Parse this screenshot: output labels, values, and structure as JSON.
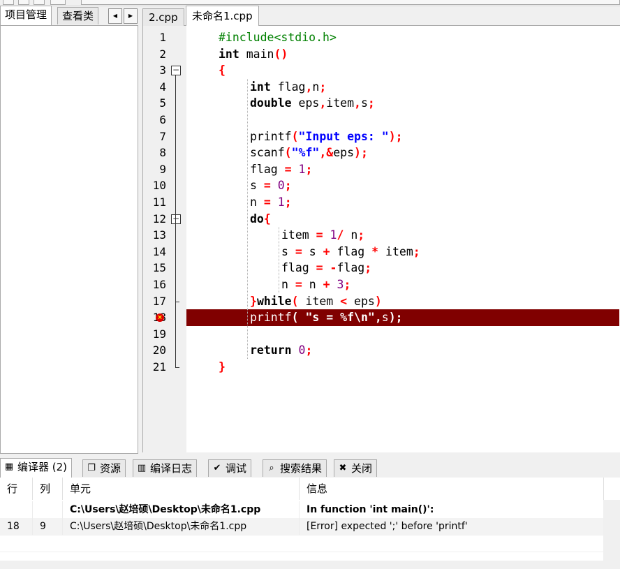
{
  "left_tabs": [
    {
      "label": "项目管理",
      "active": true
    },
    {
      "label": "查看类",
      "active": false
    }
  ],
  "left_nav": {
    "prev": "◀",
    "next": "▶"
  },
  "editor_tabs": [
    {
      "label": "2.cpp",
      "active": false
    },
    {
      "label": "未命名1.cpp",
      "active": true
    }
  ],
  "code_lines": [
    {
      "num": "1",
      "text": "#include<stdio.h>"
    },
    {
      "num": "2",
      "text": "int main()"
    },
    {
      "num": "3",
      "text": "{"
    },
    {
      "num": "4",
      "text": "int flag,n;"
    },
    {
      "num": "5",
      "text": "double eps,item,s;"
    },
    {
      "num": "6",
      "text": ""
    },
    {
      "num": "7",
      "text": "printf(\"Input eps: \");"
    },
    {
      "num": "8",
      "text": "scanf(\"%f\",&eps);"
    },
    {
      "num": "9",
      "text": "flag = 1;"
    },
    {
      "num": "10",
      "text": "s = 0;"
    },
    {
      "num": "11",
      "text": "n = 1;"
    },
    {
      "num": "12",
      "text": "do{"
    },
    {
      "num": "13",
      "text": "item = 1/ n;"
    },
    {
      "num": "14",
      "text": "s = s + flag * item;"
    },
    {
      "num": "15",
      "text": "flag = -flag;"
    },
    {
      "num": "16",
      "text": "n = n + 3;"
    },
    {
      "num": "17",
      "text": "}while( item < eps)"
    },
    {
      "num": "18",
      "text": "printf( \"s = %f\\n\",s);"
    },
    {
      "num": "19",
      "text": ""
    },
    {
      "num": "20",
      "text": "return 0;"
    },
    {
      "num": "21",
      "text": "}"
    }
  ],
  "error_line": 18,
  "bottom_tabs": [
    {
      "label": "编译器 (2)",
      "icon": "grid-icon",
      "glyph": "▦",
      "active": true
    },
    {
      "label": "资源",
      "icon": "resources-icon",
      "glyph": "❐",
      "active": false
    },
    {
      "label": "编译日志",
      "icon": "bar-chart-icon",
      "glyph": "▥",
      "active": false
    },
    {
      "label": "调试",
      "icon": "checkmark-icon",
      "glyph": "✔",
      "active": false
    },
    {
      "label": "搜索结果",
      "icon": "search-icon",
      "glyph": "⌕",
      "active": false
    },
    {
      "label": "关闭",
      "icon": "close-icon",
      "glyph": "✖",
      "active": false
    }
  ],
  "results": {
    "columns": [
      "行",
      "列",
      "单元",
      "信息"
    ],
    "rows": [
      {
        "line": "",
        "col": "",
        "unit": "C:\\Users\\赵培硕\\Desktop\\未命名1.cpp",
        "msg": "In function 'int main()':",
        "bold": true
      },
      {
        "line": "18",
        "col": "9",
        "unit": "C:\\Users\\赵培硕\\Desktop\\未命名1.cpp",
        "msg": "[Error] expected ';' before 'printf'",
        "bold": false
      }
    ]
  },
  "colors": {
    "error_line_bg": "#800000",
    "keyword": "#000000",
    "preprocessor": "#008000",
    "symbol": "#ff0000",
    "number": "#800080",
    "string": "#0000ff"
  }
}
